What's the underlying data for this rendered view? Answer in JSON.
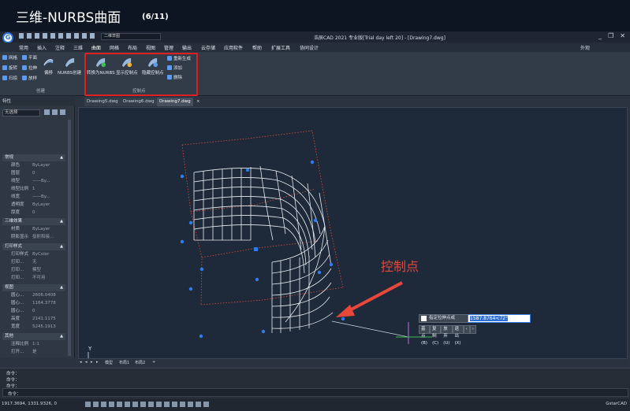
{
  "slide": {
    "title": "三维-NURBS曲面",
    "page": "(6/11)"
  },
  "app": {
    "logo": "G",
    "title": "浩辰CAD 2021 专业版[Trial day left 20] - [Drawing7.dwg]",
    "quick_access_field": "二维草图",
    "window_controls": [
      "_",
      "❐",
      "✕"
    ]
  },
  "menu": {
    "items": [
      "常用",
      "插入",
      "注释",
      "三维",
      "曲面",
      "网格",
      "布局",
      "视图",
      "管理",
      "输出",
      "云存储",
      "应用软件",
      "帮助",
      "扩展工具",
      "协同设计"
    ],
    "active": "曲面",
    "right_label": "外观"
  },
  "ribbon": {
    "create_small": [
      "网格",
      "平面",
      "旋转",
      "拉伸",
      "扫掠",
      "放样"
    ],
    "create_big": [
      "偏移",
      "NURBS创建"
    ],
    "create_label": "创建",
    "control_big": [
      "转换为NURBS",
      "显示控制点",
      "隐藏控制点"
    ],
    "control_small": [
      "重新生成",
      "添加",
      "删除"
    ],
    "control_label": "控制点"
  },
  "doc_tabs": [
    "Drawing5.dwg",
    "Drawing6.dwg",
    "Drawing7.dwg"
  ],
  "doc_tab_active": "Drawing7.dwg",
  "properties": {
    "header": "特性",
    "selection": "无选择",
    "sections": [
      {
        "title": "常规",
        "rows": [
          {
            "k": "颜色",
            "v": "ByLayer"
          },
          {
            "k": "图层",
            "v": "0"
          },
          {
            "k": "线型",
            "v": "——By..."
          },
          {
            "k": "线型比例",
            "v": "1"
          },
          {
            "k": "线宽",
            "v": "——By..."
          },
          {
            "k": "透明度",
            "v": "ByLayer"
          },
          {
            "k": "厚度",
            "v": "0"
          }
        ]
      },
      {
        "title": "三维效果",
        "rows": [
          {
            "k": "材质",
            "v": "ByLayer"
          },
          {
            "k": "阴影显示",
            "v": "投射和接..."
          }
        ]
      },
      {
        "title": "打印样式",
        "rows": [
          {
            "k": "打印样式",
            "v": "ByColor"
          },
          {
            "k": "打印...",
            "v": "无"
          },
          {
            "k": "打印...",
            "v": "模型"
          },
          {
            "k": "打印...",
            "v": "不可用"
          }
        ]
      },
      {
        "title": "视图",
        "rows": [
          {
            "k": "圆心...",
            "v": "2606.0408"
          },
          {
            "k": "圆心...",
            "v": "1164.3778"
          },
          {
            "k": "圆心...",
            "v": "0"
          },
          {
            "k": "高度",
            "v": "2141.1175"
          },
          {
            "k": "宽度",
            "v": "5245.1913"
          }
        ]
      },
      {
        "title": "其他",
        "rows": [
          {
            "k": "注释比例",
            "v": "1:1"
          },
          {
            "k": "打开...",
            "v": "是"
          }
        ]
      }
    ]
  },
  "canvas": {
    "annotation": "控制点",
    "annotation_color": "#e8473a",
    "control_point_color": "#2e7cf0",
    "ucs_x": "X",
    "ucs_y": "Y"
  },
  "command_popup": {
    "prompt": "指定拉伸点或",
    "value": "1587.8764<72°",
    "options": [
      "基点(B)",
      "复制(C)",
      "放弃(U)",
      "退出(X)",
      "‹",
      "›"
    ]
  },
  "layout_tabs": [
    "◂",
    "◂",
    "▸",
    "▸",
    "模型",
    "布局1",
    "布局2",
    "+"
  ],
  "command_history": [
    "命令：",
    "命令：",
    "命令："
  ],
  "command_prompt": "命令：",
  "status": {
    "coords": "1917.3694, 1331.9326, 0",
    "right_label": "GstarCAD"
  }
}
